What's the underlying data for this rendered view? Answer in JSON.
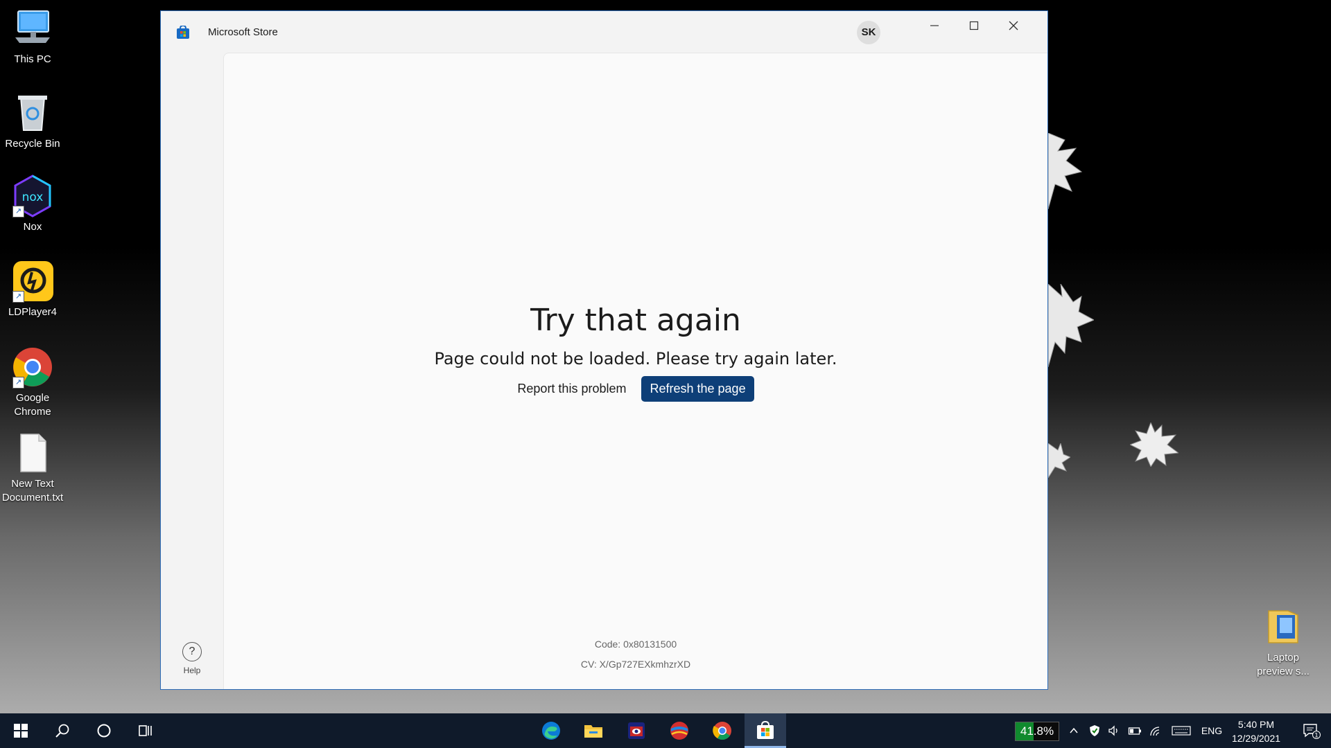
{
  "desktop": {
    "icons": [
      {
        "label": "This PC",
        "icon": "this-pc-icon"
      },
      {
        "label": "Recycle Bin",
        "icon": "recycle-bin-icon"
      },
      {
        "label": "Nox",
        "icon": "nox-icon",
        "logo_text": "nox"
      },
      {
        "label": "LDPlayer4",
        "icon": "ldplayer-icon"
      },
      {
        "label": "Google Chrome",
        "icon": "chrome-icon"
      },
      {
        "label": "New Text Document.txt",
        "icon": "text-file-icon"
      },
      {
        "label": "Laptop preview s...",
        "icon": "folder-icon"
      }
    ]
  },
  "window": {
    "title": "Microsoft Store",
    "avatar_initials": "SK",
    "controls": [
      "minimize-icon",
      "maximize-icon",
      "close-icon"
    ],
    "sidebar": {
      "help_label": "Help",
      "help_icon": "question-icon",
      "help_glyph": "?"
    },
    "error": {
      "title": "Try that again",
      "message": "Page could not be loaded. Please try again later.",
      "report_label": "Report this problem",
      "refresh_label": "Refresh the page",
      "code": "Code: 0x80131500",
      "cv": "CV: X/Gp727EXkmhzrXD"
    }
  },
  "taskbar": {
    "apps": [
      "start-icon",
      "search-icon",
      "cortana-icon",
      "task-view-icon",
      "edge-icon",
      "file-explorer-icon",
      "media-app-icon",
      "ball-app-icon",
      "chrome-icon",
      "store-icon"
    ],
    "active_app": "store-icon",
    "battery_percent": "41.8%",
    "battery_fraction": 0.418,
    "language": "ENG",
    "time": "5:40 PM",
    "date": "12/29/2021",
    "notification_count": "1",
    "colors": {
      "taskbar": "#0f1a2a",
      "accent": "#0e3f78",
      "battery_green": "#108a2e"
    }
  }
}
